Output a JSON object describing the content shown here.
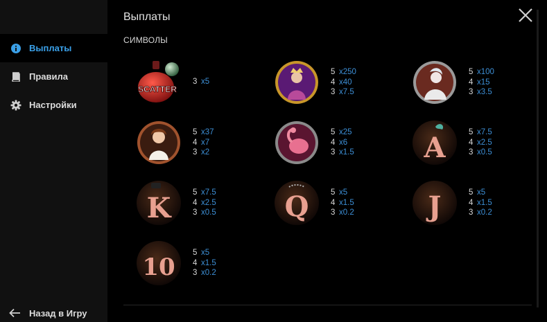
{
  "sidebar": {
    "items": [
      {
        "label": "Выплаты",
        "icon": "info-icon",
        "active": true
      },
      {
        "label": "Правила",
        "icon": "book-icon",
        "active": false
      },
      {
        "label": "Настройки",
        "icon": "gear-icon",
        "active": false
      }
    ],
    "back_label": "Назад в Игру"
  },
  "header": {
    "title": "Выплаты"
  },
  "section_title": "СИМВОЛЫ",
  "colors": {
    "accent": "#3aa0e8",
    "multiplier": "#3d8fd6",
    "sidebar_bg": "#111111",
    "panel_bg": "#000000"
  },
  "symbols": [
    {
      "name": "scatter",
      "image_text": "SCATTER",
      "pays": [
        {
          "count": "3",
          "mult": "x5"
        }
      ]
    },
    {
      "name": "queen",
      "pays": [
        {
          "count": "5",
          "mult": "x250"
        },
        {
          "count": "4",
          "mult": "x40"
        },
        {
          "count": "3",
          "mult": "x7.5"
        }
      ]
    },
    {
      "name": "lady",
      "pays": [
        {
          "count": "5",
          "mult": "x100"
        },
        {
          "count": "4",
          "mult": "x15"
        },
        {
          "count": "3",
          "mult": "x3.5"
        }
      ]
    },
    {
      "name": "girl",
      "pays": [
        {
          "count": "5",
          "mult": "x37"
        },
        {
          "count": "4",
          "mult": "x7"
        },
        {
          "count": "3",
          "mult": "x2"
        }
      ]
    },
    {
      "name": "flamingo",
      "pays": [
        {
          "count": "5",
          "mult": "x25"
        },
        {
          "count": "4",
          "mult": "x6"
        },
        {
          "count": "3",
          "mult": "x1.5"
        }
      ]
    },
    {
      "name": "letter-a",
      "image_text": "A",
      "pays": [
        {
          "count": "5",
          "mult": "x7.5"
        },
        {
          "count": "4",
          "mult": "x2.5"
        },
        {
          "count": "3",
          "mult": "x0.5"
        }
      ]
    },
    {
      "name": "letter-k",
      "image_text": "K",
      "pays": [
        {
          "count": "5",
          "mult": "x7.5"
        },
        {
          "count": "4",
          "mult": "x2.5"
        },
        {
          "count": "3",
          "mult": "x0.5"
        }
      ]
    },
    {
      "name": "letter-q",
      "image_text": "Q",
      "pays": [
        {
          "count": "5",
          "mult": "x5"
        },
        {
          "count": "4",
          "mult": "x1.5"
        },
        {
          "count": "3",
          "mult": "x0.2"
        }
      ]
    },
    {
      "name": "letter-j",
      "image_text": "J",
      "pays": [
        {
          "count": "5",
          "mult": "x5"
        },
        {
          "count": "4",
          "mult": "x1.5"
        },
        {
          "count": "3",
          "mult": "x0.2"
        }
      ]
    },
    {
      "name": "letter-10",
      "image_text": "10",
      "pays": [
        {
          "count": "5",
          "mult": "x5"
        },
        {
          "count": "4",
          "mult": "x1.5"
        },
        {
          "count": "3",
          "mult": "x0.2"
        }
      ]
    }
  ]
}
